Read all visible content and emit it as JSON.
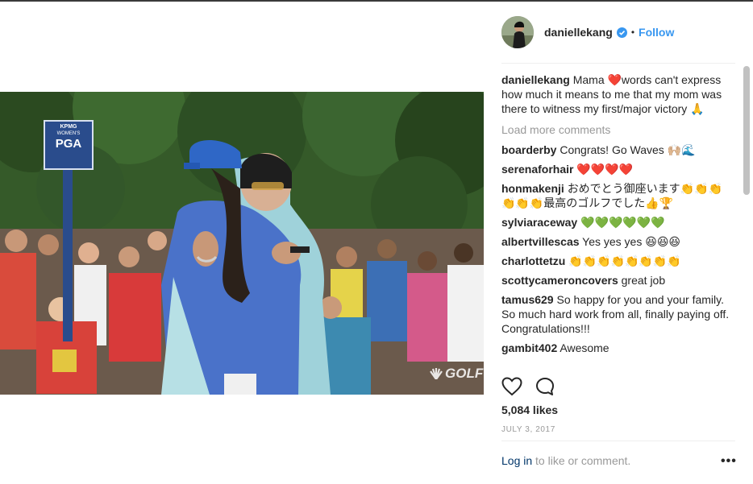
{
  "post": {
    "username": "daniellekang",
    "follow_label": "Follow",
    "separator": "•",
    "caption_text": "Mama ❤️words can't express how much it means to me that my mom was there to witness my first/major victory 🙏",
    "load_more": "Load more comments",
    "comments": [
      {
        "user": "boarderby",
        "text": "Congrats! Go Waves 🙌🏼🌊"
      },
      {
        "user": "serenaforhair",
        "text": "❤️❤️❤️❤️"
      },
      {
        "user": "honmakenji",
        "text": "おめでとう御座います👏👏👏👏👏👏最高のゴルフでした👍🏆"
      },
      {
        "user": "sylviaraceway",
        "text": "💚💚💚💚💚💚"
      },
      {
        "user": "albertvillescas",
        "text": "Yes yes yes 😆😆😆"
      },
      {
        "user": "charlottetzu",
        "text": "👏👏👏👏👏👏👏👏"
      },
      {
        "user": "scottycameroncovers",
        "text": "great job"
      },
      {
        "user": "tamus629",
        "text": "So happy for you and your family. So much hard work from all, finally paying off. Congratulations!!!"
      },
      {
        "user": "gambit402",
        "text": "Awesome"
      }
    ],
    "likes": "5,084 likes",
    "date": "JULY 3, 2017",
    "footer": {
      "login_label": "Log in",
      "rest": " to like or comment.",
      "more_label": "•••"
    }
  },
  "video": {
    "sign_lines": [
      "KPMG",
      "WOMEN'S",
      "PGA"
    ],
    "watermark": "GOLF"
  },
  "colors": {
    "accent_blue": "#3897f0",
    "verified_blue": "#3897f0",
    "link_dark": "#003569",
    "muted_gray": "#999999",
    "heart_red": "#ed4956"
  },
  "icons": [
    "verified-badge-icon",
    "heart-icon",
    "comment-icon",
    "more-options-icon",
    "nbc-peacock-icon"
  ]
}
